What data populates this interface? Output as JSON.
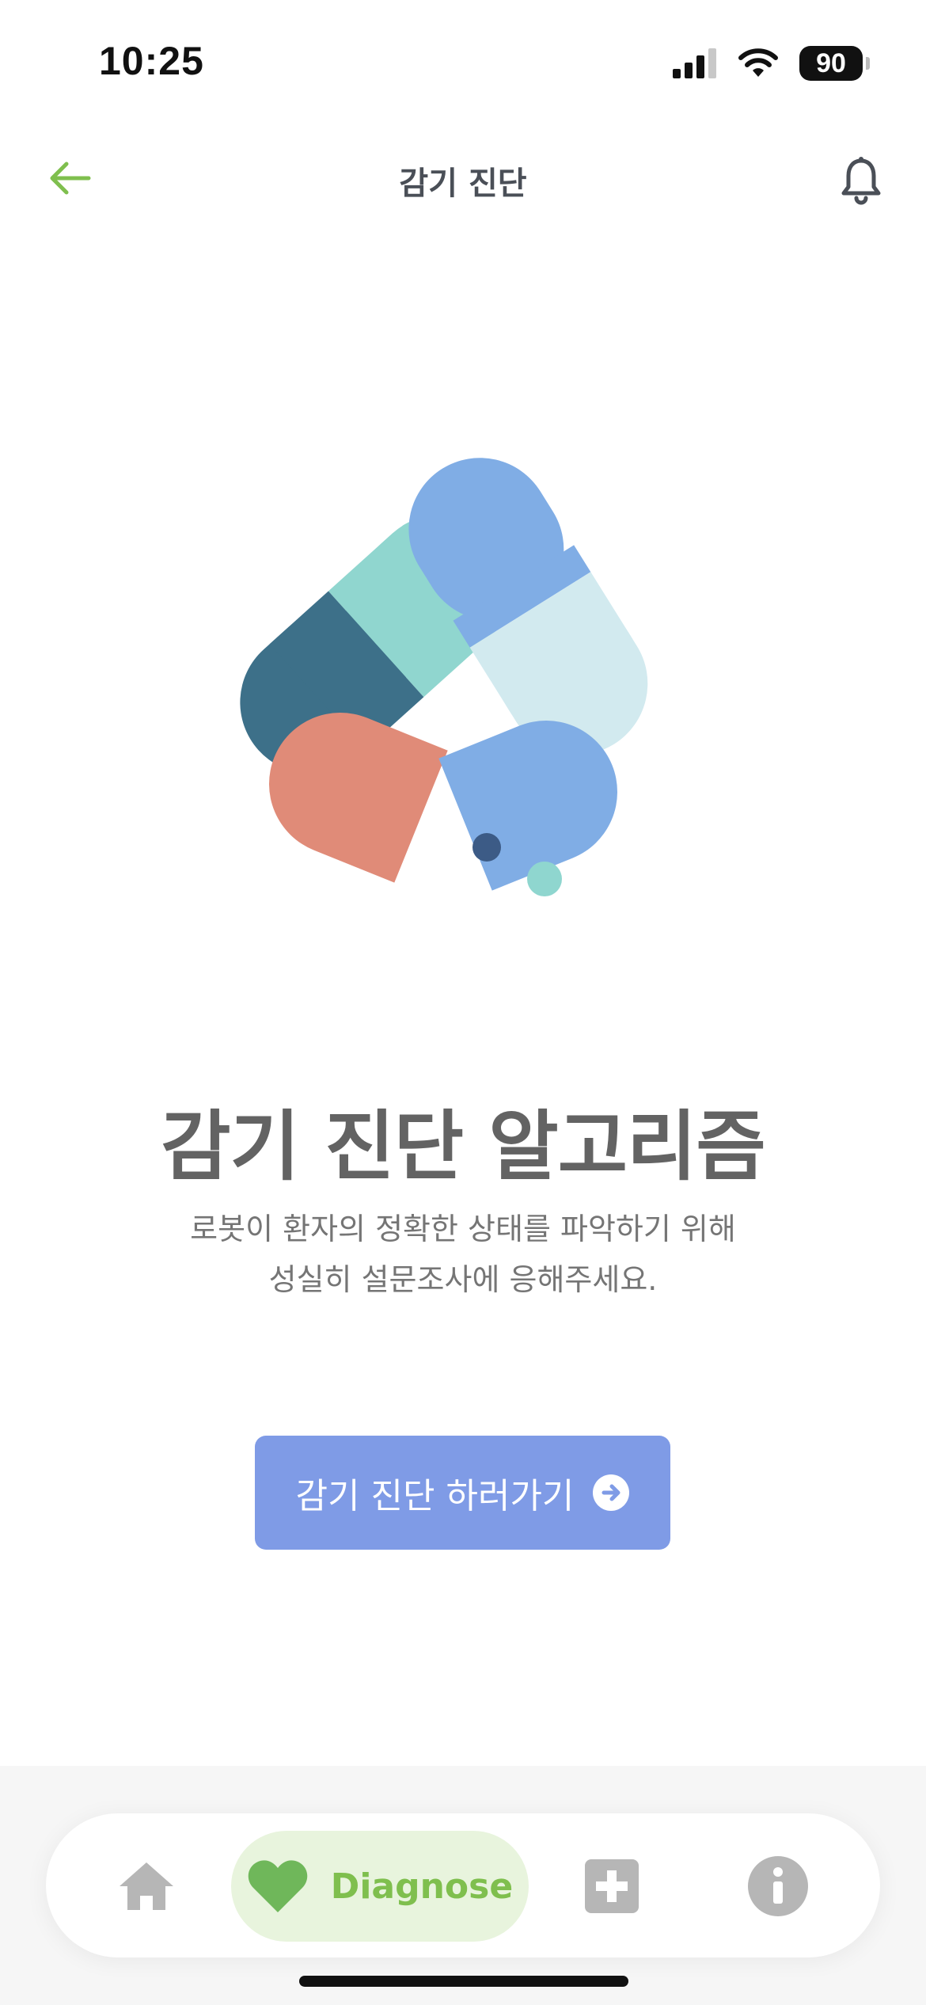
{
  "status_bar": {
    "time": "10:25",
    "battery": "90"
  },
  "header": {
    "title": "감기 진단",
    "back_icon": "arrow-left-icon",
    "notification_icon": "bell-icon"
  },
  "hero": {
    "illustration": "pill-capsules-illustration",
    "title": "감기 진단 알고리즘",
    "description_line1": "로봇이 환자의 정확한 상태를 파악하기 위해",
    "description_line2": "성실히 설문조사에 응해주세요."
  },
  "cta": {
    "label": "감기 진단 하러가기",
    "icon": "arrow-right-circle-icon"
  },
  "bottom_nav": {
    "items": [
      {
        "name": "home",
        "icon": "home-icon"
      },
      {
        "name": "diagnose",
        "icon": "heart-icon",
        "label": "Diagnose",
        "active": true
      },
      {
        "name": "medical",
        "icon": "plus-square-icon"
      },
      {
        "name": "info",
        "icon": "info-icon"
      }
    ]
  },
  "colors": {
    "accent_green": "#7fbf4e",
    "cta_blue": "#7f9be6",
    "active_tab_bg": "#e8f4dd",
    "title_gray": "#636363"
  }
}
